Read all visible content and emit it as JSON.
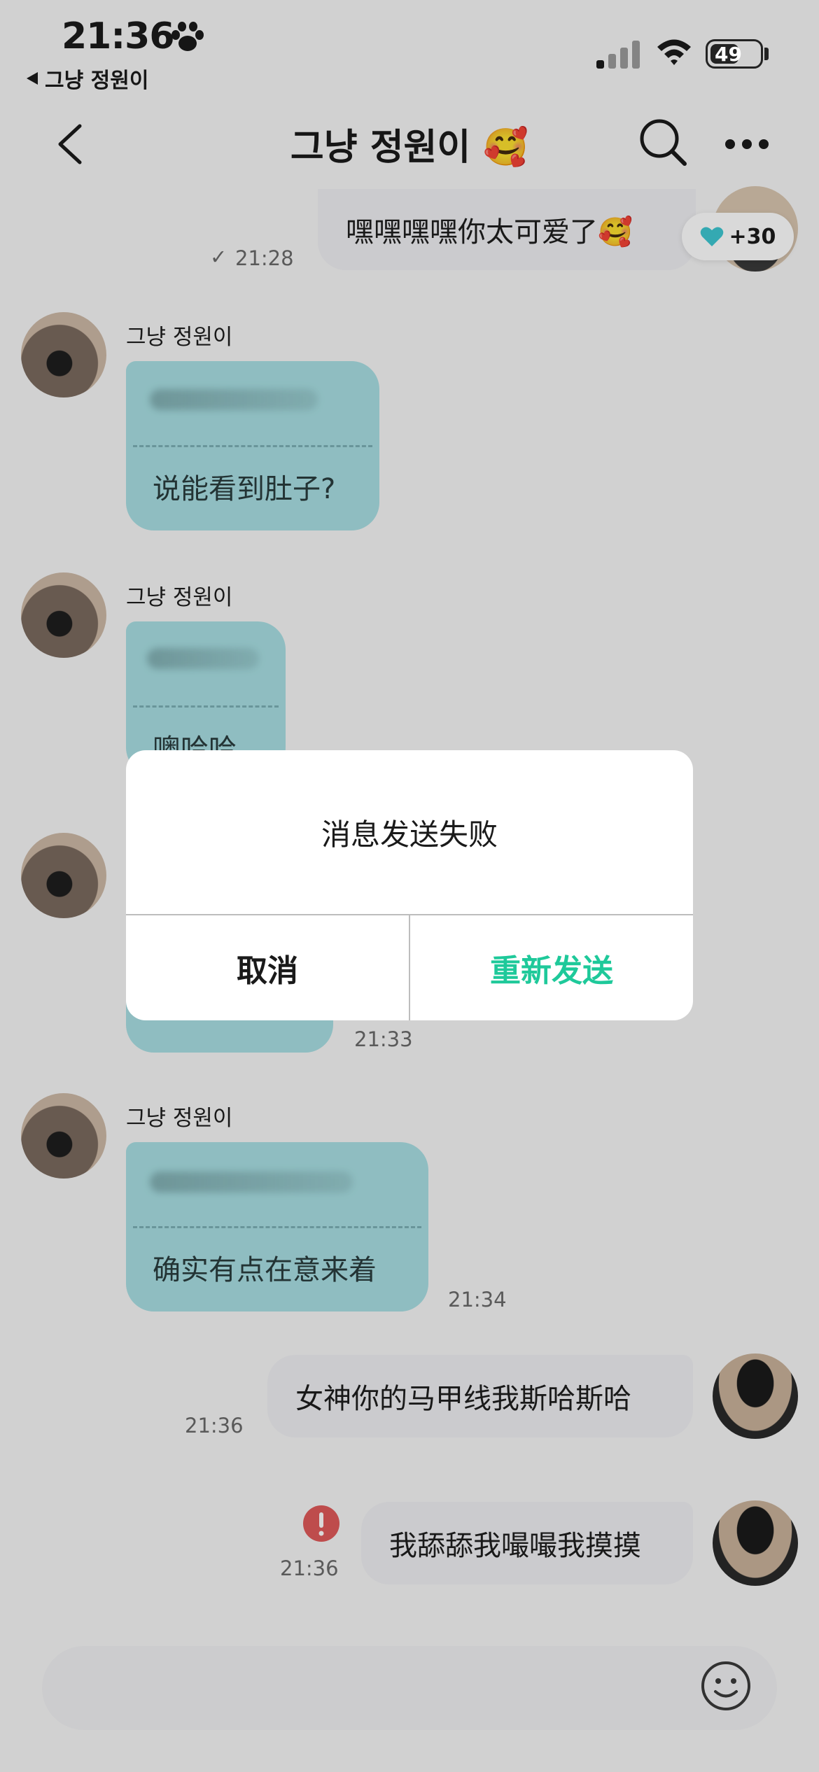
{
  "status_bar": {
    "time": "21:36",
    "back_app": "그냥 정원이",
    "battery": "49"
  },
  "header": {
    "title": "그냥 정원이 🥰"
  },
  "messages": {
    "m0": {
      "text": "嘿嘿嘿嘿你太可爱了🥰",
      "time": "21:28",
      "reaction": "+30"
    },
    "m1": {
      "sender": "그냥 정원이",
      "translation": "说能看到肚子?"
    },
    "m2": {
      "sender": "그냥 정원이",
      "translation": "噢哈哈"
    },
    "m3": {
      "time": "21:33"
    },
    "m4": {
      "sender": "그냥 정원이",
      "translation": "确实有点在意来着",
      "time": "21:34"
    },
    "m5": {
      "text": "女神你的马甲线我斯哈斯哈",
      "time": "21:36"
    },
    "m6": {
      "text": "我舔舔我嘬嘬我摸摸",
      "time": "21:36"
    }
  },
  "dialog": {
    "title": "消息发送失败",
    "cancel": "取消",
    "resend": "重新发送"
  },
  "colors": {
    "accent": "#1ec99a",
    "bubble_them": "#a8dfe3",
    "bubble_me": "#efeff2",
    "error": "#e05a5a"
  }
}
